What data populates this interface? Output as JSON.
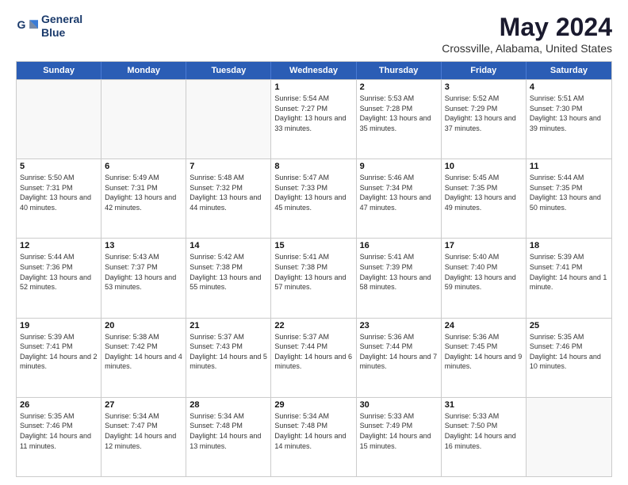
{
  "logo": {
    "line1": "General",
    "line2": "Blue"
  },
  "title": "May 2024",
  "subtitle": "Crossville, Alabama, United States",
  "header_days": [
    "Sunday",
    "Monday",
    "Tuesday",
    "Wednesday",
    "Thursday",
    "Friday",
    "Saturday"
  ],
  "rows": [
    [
      {
        "day": "",
        "sunrise": "",
        "sunset": "",
        "daylight": ""
      },
      {
        "day": "",
        "sunrise": "",
        "sunset": "",
        "daylight": ""
      },
      {
        "day": "",
        "sunrise": "",
        "sunset": "",
        "daylight": ""
      },
      {
        "day": "1",
        "sunrise": "Sunrise: 5:54 AM",
        "sunset": "Sunset: 7:27 PM",
        "daylight": "Daylight: 13 hours and 33 minutes."
      },
      {
        "day": "2",
        "sunrise": "Sunrise: 5:53 AM",
        "sunset": "Sunset: 7:28 PM",
        "daylight": "Daylight: 13 hours and 35 minutes."
      },
      {
        "day": "3",
        "sunrise": "Sunrise: 5:52 AM",
        "sunset": "Sunset: 7:29 PM",
        "daylight": "Daylight: 13 hours and 37 minutes."
      },
      {
        "day": "4",
        "sunrise": "Sunrise: 5:51 AM",
        "sunset": "Sunset: 7:30 PM",
        "daylight": "Daylight: 13 hours and 39 minutes."
      }
    ],
    [
      {
        "day": "5",
        "sunrise": "Sunrise: 5:50 AM",
        "sunset": "Sunset: 7:31 PM",
        "daylight": "Daylight: 13 hours and 40 minutes."
      },
      {
        "day": "6",
        "sunrise": "Sunrise: 5:49 AM",
        "sunset": "Sunset: 7:31 PM",
        "daylight": "Daylight: 13 hours and 42 minutes."
      },
      {
        "day": "7",
        "sunrise": "Sunrise: 5:48 AM",
        "sunset": "Sunset: 7:32 PM",
        "daylight": "Daylight: 13 hours and 44 minutes."
      },
      {
        "day": "8",
        "sunrise": "Sunrise: 5:47 AM",
        "sunset": "Sunset: 7:33 PM",
        "daylight": "Daylight: 13 hours and 45 minutes."
      },
      {
        "day": "9",
        "sunrise": "Sunrise: 5:46 AM",
        "sunset": "Sunset: 7:34 PM",
        "daylight": "Daylight: 13 hours and 47 minutes."
      },
      {
        "day": "10",
        "sunrise": "Sunrise: 5:45 AM",
        "sunset": "Sunset: 7:35 PM",
        "daylight": "Daylight: 13 hours and 49 minutes."
      },
      {
        "day": "11",
        "sunrise": "Sunrise: 5:44 AM",
        "sunset": "Sunset: 7:35 PM",
        "daylight": "Daylight: 13 hours and 50 minutes."
      }
    ],
    [
      {
        "day": "12",
        "sunrise": "Sunrise: 5:44 AM",
        "sunset": "Sunset: 7:36 PM",
        "daylight": "Daylight: 13 hours and 52 minutes."
      },
      {
        "day": "13",
        "sunrise": "Sunrise: 5:43 AM",
        "sunset": "Sunset: 7:37 PM",
        "daylight": "Daylight: 13 hours and 53 minutes."
      },
      {
        "day": "14",
        "sunrise": "Sunrise: 5:42 AM",
        "sunset": "Sunset: 7:38 PM",
        "daylight": "Daylight: 13 hours and 55 minutes."
      },
      {
        "day": "15",
        "sunrise": "Sunrise: 5:41 AM",
        "sunset": "Sunset: 7:38 PM",
        "daylight": "Daylight: 13 hours and 57 minutes."
      },
      {
        "day": "16",
        "sunrise": "Sunrise: 5:41 AM",
        "sunset": "Sunset: 7:39 PM",
        "daylight": "Daylight: 13 hours and 58 minutes."
      },
      {
        "day": "17",
        "sunrise": "Sunrise: 5:40 AM",
        "sunset": "Sunset: 7:40 PM",
        "daylight": "Daylight: 13 hours and 59 minutes."
      },
      {
        "day": "18",
        "sunrise": "Sunrise: 5:39 AM",
        "sunset": "Sunset: 7:41 PM",
        "daylight": "Daylight: 14 hours and 1 minute."
      }
    ],
    [
      {
        "day": "19",
        "sunrise": "Sunrise: 5:39 AM",
        "sunset": "Sunset: 7:41 PM",
        "daylight": "Daylight: 14 hours and 2 minutes."
      },
      {
        "day": "20",
        "sunrise": "Sunrise: 5:38 AM",
        "sunset": "Sunset: 7:42 PM",
        "daylight": "Daylight: 14 hours and 4 minutes."
      },
      {
        "day": "21",
        "sunrise": "Sunrise: 5:37 AM",
        "sunset": "Sunset: 7:43 PM",
        "daylight": "Daylight: 14 hours and 5 minutes."
      },
      {
        "day": "22",
        "sunrise": "Sunrise: 5:37 AM",
        "sunset": "Sunset: 7:44 PM",
        "daylight": "Daylight: 14 hours and 6 minutes."
      },
      {
        "day": "23",
        "sunrise": "Sunrise: 5:36 AM",
        "sunset": "Sunset: 7:44 PM",
        "daylight": "Daylight: 14 hours and 7 minutes."
      },
      {
        "day": "24",
        "sunrise": "Sunrise: 5:36 AM",
        "sunset": "Sunset: 7:45 PM",
        "daylight": "Daylight: 14 hours and 9 minutes."
      },
      {
        "day": "25",
        "sunrise": "Sunrise: 5:35 AM",
        "sunset": "Sunset: 7:46 PM",
        "daylight": "Daylight: 14 hours and 10 minutes."
      }
    ],
    [
      {
        "day": "26",
        "sunrise": "Sunrise: 5:35 AM",
        "sunset": "Sunset: 7:46 PM",
        "daylight": "Daylight: 14 hours and 11 minutes."
      },
      {
        "day": "27",
        "sunrise": "Sunrise: 5:34 AM",
        "sunset": "Sunset: 7:47 PM",
        "daylight": "Daylight: 14 hours and 12 minutes."
      },
      {
        "day": "28",
        "sunrise": "Sunrise: 5:34 AM",
        "sunset": "Sunset: 7:48 PM",
        "daylight": "Daylight: 14 hours and 13 minutes."
      },
      {
        "day": "29",
        "sunrise": "Sunrise: 5:34 AM",
        "sunset": "Sunset: 7:48 PM",
        "daylight": "Daylight: 14 hours and 14 minutes."
      },
      {
        "day": "30",
        "sunrise": "Sunrise: 5:33 AM",
        "sunset": "Sunset: 7:49 PM",
        "daylight": "Daylight: 14 hours and 15 minutes."
      },
      {
        "day": "31",
        "sunrise": "Sunrise: 5:33 AM",
        "sunset": "Sunset: 7:50 PM",
        "daylight": "Daylight: 14 hours and 16 minutes."
      },
      {
        "day": "",
        "sunrise": "",
        "sunset": "",
        "daylight": ""
      }
    ]
  ]
}
